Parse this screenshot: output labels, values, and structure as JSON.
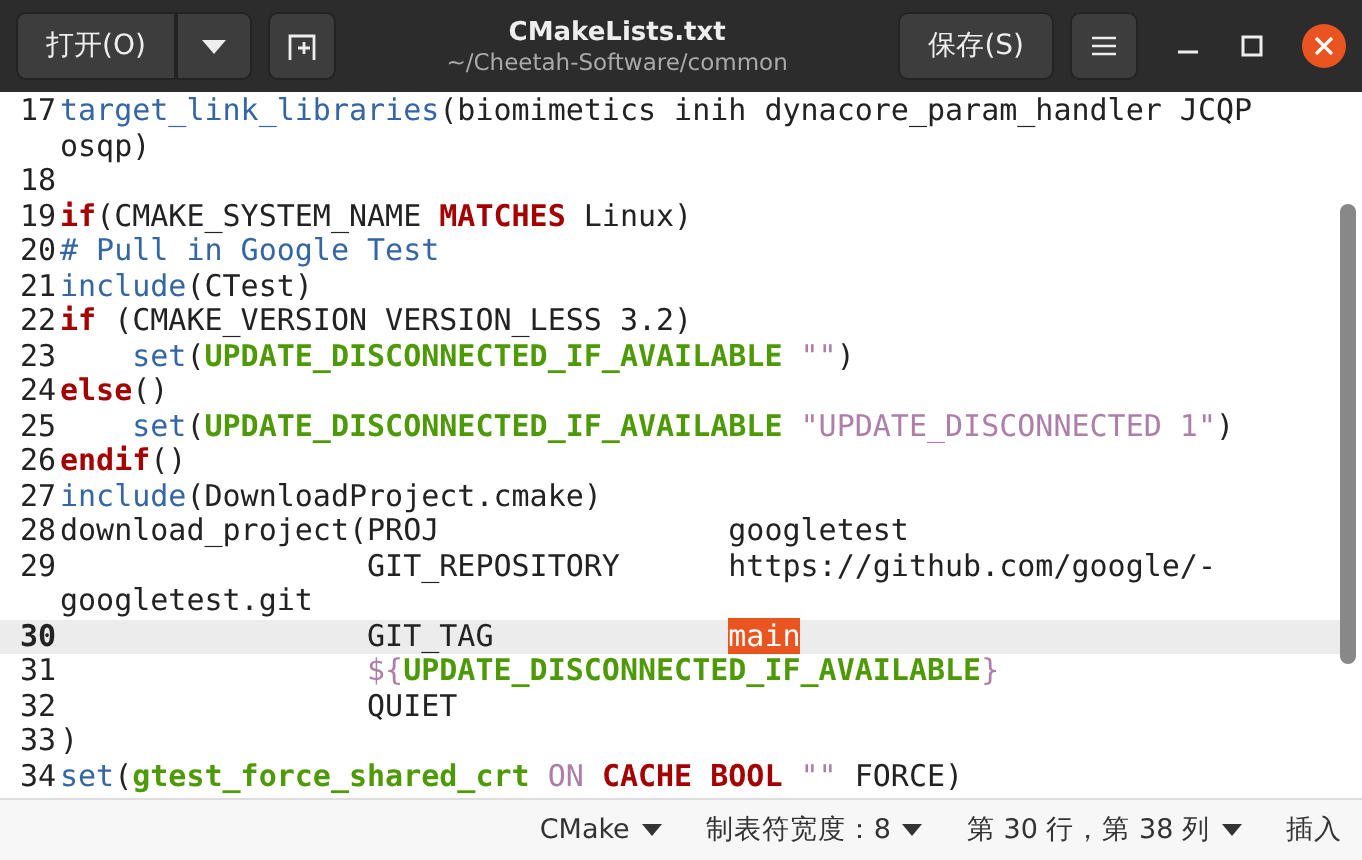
{
  "header": {
    "open_button": "打开(O)",
    "title": "CMakeLists.txt",
    "subtitle": "~/Cheetah-Software/common",
    "save_button": "保存(S)"
  },
  "editor": {
    "lines": [
      {
        "number": "17",
        "current": false,
        "rows": [
          [
            {
              "kind": "func",
              "text": "target_link_libraries"
            },
            {
              "kind": "plain",
              "text": "(biomimetics inih dynacore_param_handler JCQP"
            }
          ],
          [
            {
              "kind": "plain",
              "text": "osqp)"
            }
          ]
        ]
      },
      {
        "number": "18",
        "current": false,
        "rows": [
          []
        ]
      },
      {
        "number": "19",
        "current": false,
        "rows": [
          [
            {
              "kind": "keyword",
              "text": "if"
            },
            {
              "kind": "plain",
              "text": "(CMAKE_SYSTEM_NAME "
            },
            {
              "kind": "keyword",
              "text": "MATCHES"
            },
            {
              "kind": "plain",
              "text": " Linux)"
            }
          ]
        ]
      },
      {
        "number": "20",
        "current": false,
        "rows": [
          [
            {
              "kind": "comment",
              "text": "# Pull in Google Test"
            }
          ]
        ]
      },
      {
        "number": "21",
        "current": false,
        "rows": [
          [
            {
              "kind": "func",
              "text": "include"
            },
            {
              "kind": "plain",
              "text": "(CTest)"
            }
          ]
        ]
      },
      {
        "number": "22",
        "current": false,
        "rows": [
          [
            {
              "kind": "keyword",
              "text": "if"
            },
            {
              "kind": "plain",
              "text": " (CMAKE_VERSION VERSION_LESS 3.2)"
            }
          ]
        ]
      },
      {
        "number": "23",
        "current": false,
        "rows": [
          [
            {
              "kind": "plain",
              "text": "    "
            },
            {
              "kind": "func",
              "text": "set"
            },
            {
              "kind": "plain",
              "text": "("
            },
            {
              "kind": "variable",
              "text": "UPDATE_DISCONNECTED_IF_AVAILABLE"
            },
            {
              "kind": "plain",
              "text": " "
            },
            {
              "kind": "string",
              "text": "\"\""
            },
            {
              "kind": "plain",
              "text": ")"
            }
          ]
        ]
      },
      {
        "number": "24",
        "current": false,
        "rows": [
          [
            {
              "kind": "keyword",
              "text": "else"
            },
            {
              "kind": "plain",
              "text": "()"
            }
          ]
        ]
      },
      {
        "number": "25",
        "current": false,
        "rows": [
          [
            {
              "kind": "plain",
              "text": "    "
            },
            {
              "kind": "func",
              "text": "set"
            },
            {
              "kind": "plain",
              "text": "("
            },
            {
              "kind": "variable",
              "text": "UPDATE_DISCONNECTED_IF_AVAILABLE"
            },
            {
              "kind": "plain",
              "text": " "
            },
            {
              "kind": "string",
              "text": "\"UPDATE_DISCONNECTED 1\""
            },
            {
              "kind": "plain",
              "text": ")"
            }
          ]
        ]
      },
      {
        "number": "26",
        "current": false,
        "rows": [
          [
            {
              "kind": "keyword",
              "text": "endif"
            },
            {
              "kind": "plain",
              "text": "()"
            }
          ]
        ]
      },
      {
        "number": "27",
        "current": false,
        "rows": [
          [
            {
              "kind": "func",
              "text": "include"
            },
            {
              "kind": "plain",
              "text": "(DownloadProject.cmake)"
            }
          ]
        ]
      },
      {
        "number": "28",
        "current": false,
        "rows": [
          [
            {
              "kind": "plain",
              "text": "download_project(PROJ                googletest"
            }
          ]
        ]
      },
      {
        "number": "29",
        "current": false,
        "rows": [
          [
            {
              "kind": "plain",
              "text": "                 GIT_REPOSITORY      https://github.com/google/-"
            }
          ],
          [
            {
              "kind": "plain",
              "text": "googletest.git"
            }
          ]
        ]
      },
      {
        "number": "30",
        "current": true,
        "rows": [
          [
            {
              "kind": "plain",
              "text": "                 GIT_TAG             "
            },
            {
              "kind": "match",
              "text": "main"
            }
          ]
        ]
      },
      {
        "number": "31",
        "current": false,
        "rows": [
          [
            {
              "kind": "plain",
              "text": "                 "
            },
            {
              "kind": "string",
              "text": "${"
            },
            {
              "kind": "variable",
              "text": "UPDATE_DISCONNECTED_IF_AVAILABLE"
            },
            {
              "kind": "string",
              "text": "}"
            }
          ]
        ]
      },
      {
        "number": "32",
        "current": false,
        "rows": [
          [
            {
              "kind": "plain",
              "text": "                 QUIET"
            }
          ]
        ]
      },
      {
        "number": "33",
        "current": false,
        "rows": [
          [
            {
              "kind": "plain",
              "text": ")"
            }
          ]
        ]
      },
      {
        "number": "34",
        "current": false,
        "rows": [
          [
            {
              "kind": "func",
              "text": "set"
            },
            {
              "kind": "plain",
              "text": "("
            },
            {
              "kind": "variable",
              "text": "gtest_force_shared_crt"
            },
            {
              "kind": "plain",
              "text": " "
            },
            {
              "kind": "string",
              "text": "ON"
            },
            {
              "kind": "plain",
              "text": " "
            },
            {
              "kind": "keyword",
              "text": "CACHE BOOL"
            },
            {
              "kind": "plain",
              "text": " "
            },
            {
              "kind": "string",
              "text": "\"\""
            },
            {
              "kind": "plain",
              "text": " FORCE)"
            }
          ]
        ]
      }
    ]
  },
  "status_bar": {
    "language": "CMake",
    "tab_width": "制表符宽度：8",
    "position": "第 30 行，第 38 列",
    "mode": "插入"
  }
}
